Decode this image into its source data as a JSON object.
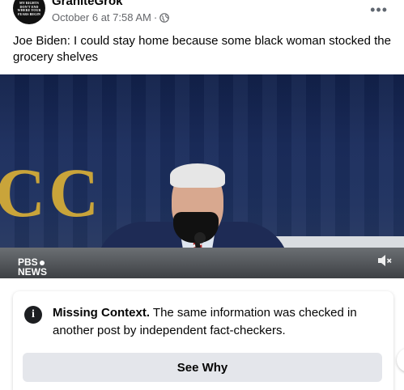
{
  "post": {
    "page_name": "GraniteGrok",
    "avatar_text": "MY RIGHTS DON'T END WHERE YOUR FEARS BEGIN",
    "timestamp": "October 6 at 7:58 AM",
    "separator": "·",
    "audience_icon": "globe-icon",
    "more_icon": "more-options-icon",
    "more_glyph": "•••",
    "text": "Joe Biden:  I could stay home because some black woman stocked the grocery shelves"
  },
  "video": {
    "backdrop_letters": "CC",
    "watermark": {
      "line1": "PBS",
      "line2": "NEWS"
    },
    "volume_icon": "muted-speaker-icon"
  },
  "fact_check": {
    "icon": "info-icon",
    "icon_glyph": "i",
    "title": "Missing Context.",
    "message": "The same information was checked in another post by independent fact-checkers.",
    "button_label": "See Why"
  },
  "colors": {
    "text_primary": "#050505",
    "text_secondary": "#65676b",
    "button_bg": "#e4e6eb"
  }
}
